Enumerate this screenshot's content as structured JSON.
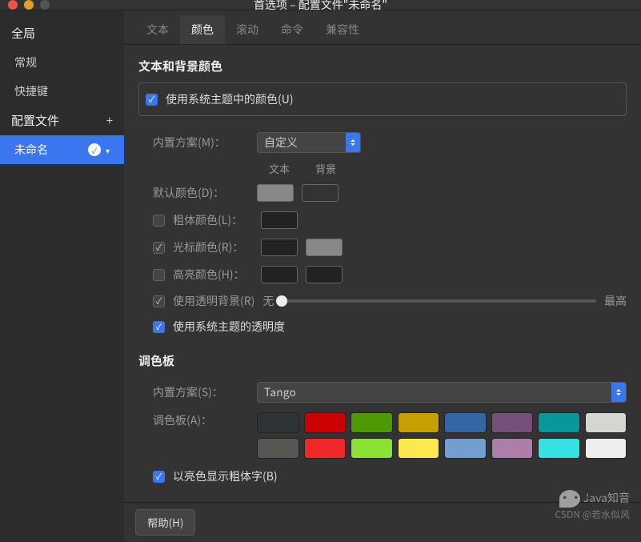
{
  "title": "首选项 – 配置文件\"未命名\"",
  "sidebar": {
    "global": "全局",
    "general": "常规",
    "shortcuts": "快捷键",
    "profiles": "配置文件",
    "profile_name": "未命名"
  },
  "tabs": [
    "文本",
    "颜色",
    "滚动",
    "命令",
    "兼容性"
  ],
  "text_bg": {
    "heading": "文本和背景颜色",
    "use_system": "使用系统主题中的颜色(U)",
    "builtin_scheme": "内置方案(M)：",
    "builtin_value": "自定义",
    "col_text": "文本",
    "col_bg": "背景",
    "default_color": "默认颜色(D)：",
    "bold_color": "粗体颜色(L)：",
    "cursor_color": "光标颜色(R)：",
    "highlight_color": "高亮颜色(H)：",
    "transparent_bg": "使用透明背景(R)",
    "none": "无",
    "max": "最高",
    "use_system_trans": "使用系统主题的透明度"
  },
  "palette": {
    "heading": "调色板",
    "builtin_scheme": "内置方案(S)：",
    "builtin_value": "Tango",
    "palette_label": "调色板(A)：",
    "bright_bold": "以亮色显示粗体字(B)",
    "colors": [
      "#2e3436",
      "#cc0000",
      "#4e9a06",
      "#c4a000",
      "#3465a4",
      "#75507b",
      "#06989a",
      "#d3d7cf",
      "#555753",
      "#ef2929",
      "#8ae234",
      "#fce94f",
      "#729fcf",
      "#ad7fa8",
      "#34e2e2",
      "#eeeeec"
    ]
  },
  "swatches": {
    "default_text": "#888888",
    "default_bg": "#333333",
    "bold_text": "#222222",
    "cursor_text": "#222222",
    "cursor_bg": "#888888",
    "highlight_text": "#222222",
    "highlight_bg": "#222222"
  },
  "help": "帮助(H)",
  "watermark": {
    "line1": "Java知音",
    "line2": "CSDN @若水似风"
  }
}
